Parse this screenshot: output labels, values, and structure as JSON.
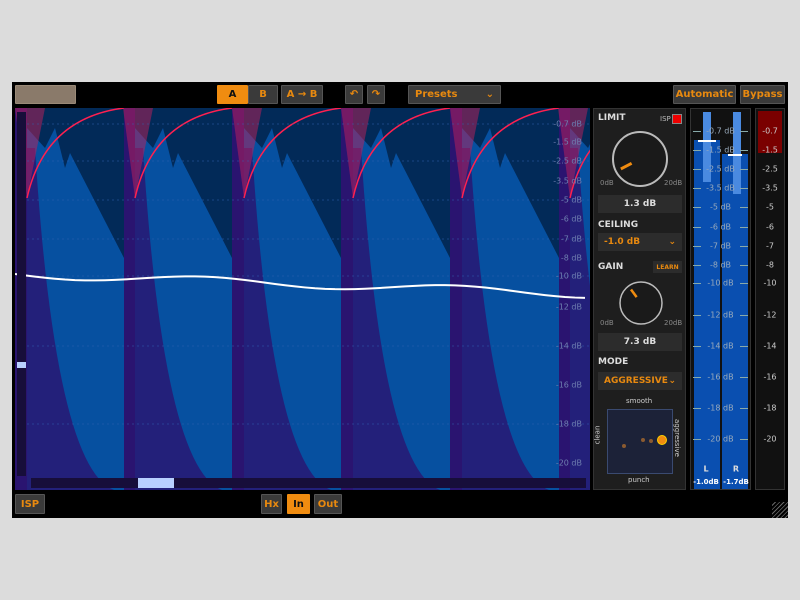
{
  "toolbar": {
    "a": "A",
    "b": "B",
    "a_to_b": "A → B",
    "undo_icon": "undo-arrow",
    "redo_icon": "redo-arrow",
    "presets": "Presets",
    "automatic": "Automatic",
    "bypass": "Bypass"
  },
  "graph": {
    "db_labels": [
      "-0.7 dB",
      "-1.5 dB",
      "-2.5 dB",
      "-3.5 dB",
      "-5 dB",
      "-6 dB",
      "-7 dB",
      "-8 dB",
      "-10 dB",
      "-12 dB",
      "-14 dB",
      "-16 dB",
      "-18 dB",
      "-20 dB"
    ]
  },
  "bottom": {
    "isp": "ISP",
    "hx": "Hx",
    "in": "In",
    "out": "Out"
  },
  "panel": {
    "limit": "LIMIT",
    "isp": "ISP",
    "limit_min": "0dB",
    "limit_max": "20dB",
    "limit_value": "1.3 dB",
    "limit_fraction": 0.065,
    "ceiling": "CEILING",
    "ceiling_value": "-1.0 dB",
    "gain": "GAIN",
    "learn": "LEARN",
    "gain_min": "0dB",
    "gain_max": "20dB",
    "gain_value": "7.3 dB",
    "gain_fraction": 0.365,
    "mode": "MODE",
    "mode_value": "AGGRESSIVE",
    "xy": {
      "top": "smooth",
      "bottom": "punch",
      "left": "clean",
      "right": "aggressive"
    }
  },
  "meter": {
    "labels": [
      "-0.7 dB",
      "-1.5 dB",
      "-2.5 dB",
      "-3.5 dB",
      "-5 dB",
      "-6 dB",
      "-7 dB",
      "-8 dB",
      "-10 dB",
      "-12 dB",
      "-14 dB",
      "-16 dB",
      "-18 dB",
      "-20 dB"
    ],
    "left": {
      "name": "L",
      "value": "-1.0dB"
    },
    "right": {
      "name": "R",
      "value": "-1.7dB"
    }
  },
  "scale": {
    "labels": [
      "-0.7",
      "-1.5",
      "-2.5",
      "-3.5",
      "-5",
      "-6",
      "-7",
      "-8",
      "-10",
      "-12",
      "-14",
      "-16",
      "-18",
      "-20"
    ]
  },
  "colors": {
    "accent": "#f08c10",
    "clip": "#7a0000",
    "meter": "#0a4fb0"
  }
}
